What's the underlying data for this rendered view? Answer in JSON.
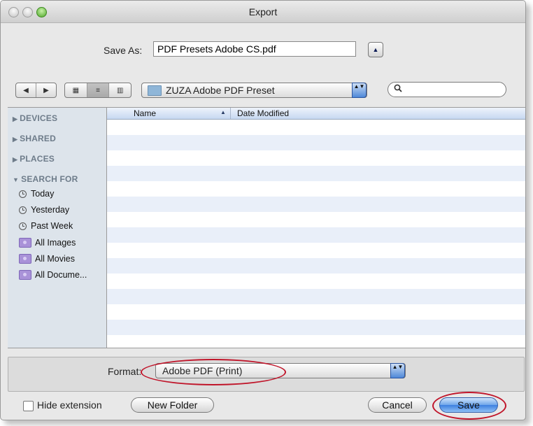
{
  "window": {
    "title": "Export"
  },
  "save_as": {
    "label": "Save As:",
    "value": "PDF Presets Adobe CS.pdf",
    "expand_glyph": "▲"
  },
  "toolbar": {
    "back_glyph": "◀",
    "forward_glyph": "▶",
    "icon_view_glyph": "▦",
    "list_view_glyph": "≡",
    "column_view_glyph": "▥",
    "active_view": "list",
    "location_folder": "ZUZA Adobe PDF Preset",
    "popup_arrows": "▲▼",
    "search_glyph": "🔍",
    "search_value": ""
  },
  "sidebar": {
    "sections": [
      {
        "label": "DEVICES",
        "expanded": false
      },
      {
        "label": "SHARED",
        "expanded": false
      },
      {
        "label": "PLACES",
        "expanded": false
      },
      {
        "label": "SEARCH FOR",
        "expanded": true
      }
    ],
    "search_items": [
      {
        "label": "Today",
        "icon": "clock-icon"
      },
      {
        "label": "Yesterday",
        "icon": "clock-icon"
      },
      {
        "label": "Past Week",
        "icon": "clock-icon"
      },
      {
        "label": "All Images",
        "icon": "smart-folder-icon"
      },
      {
        "label": "All Movies",
        "icon": "smart-folder-icon"
      },
      {
        "label": "All Docume...",
        "icon": "smart-folder-icon"
      }
    ]
  },
  "file_list": {
    "columns": [
      "Name",
      "Date Modified"
    ],
    "sort_column": "Name",
    "sort_glyph": "▲",
    "rows": []
  },
  "format": {
    "label": "Format:",
    "value": "Adobe PDF (Print)"
  },
  "footer": {
    "hide_extension_label": "Hide extension",
    "hide_extension_checked": false,
    "new_folder_label": "New Folder",
    "cancel_label": "Cancel",
    "save_label": "Save"
  },
  "annotation_color": "#c0152a"
}
